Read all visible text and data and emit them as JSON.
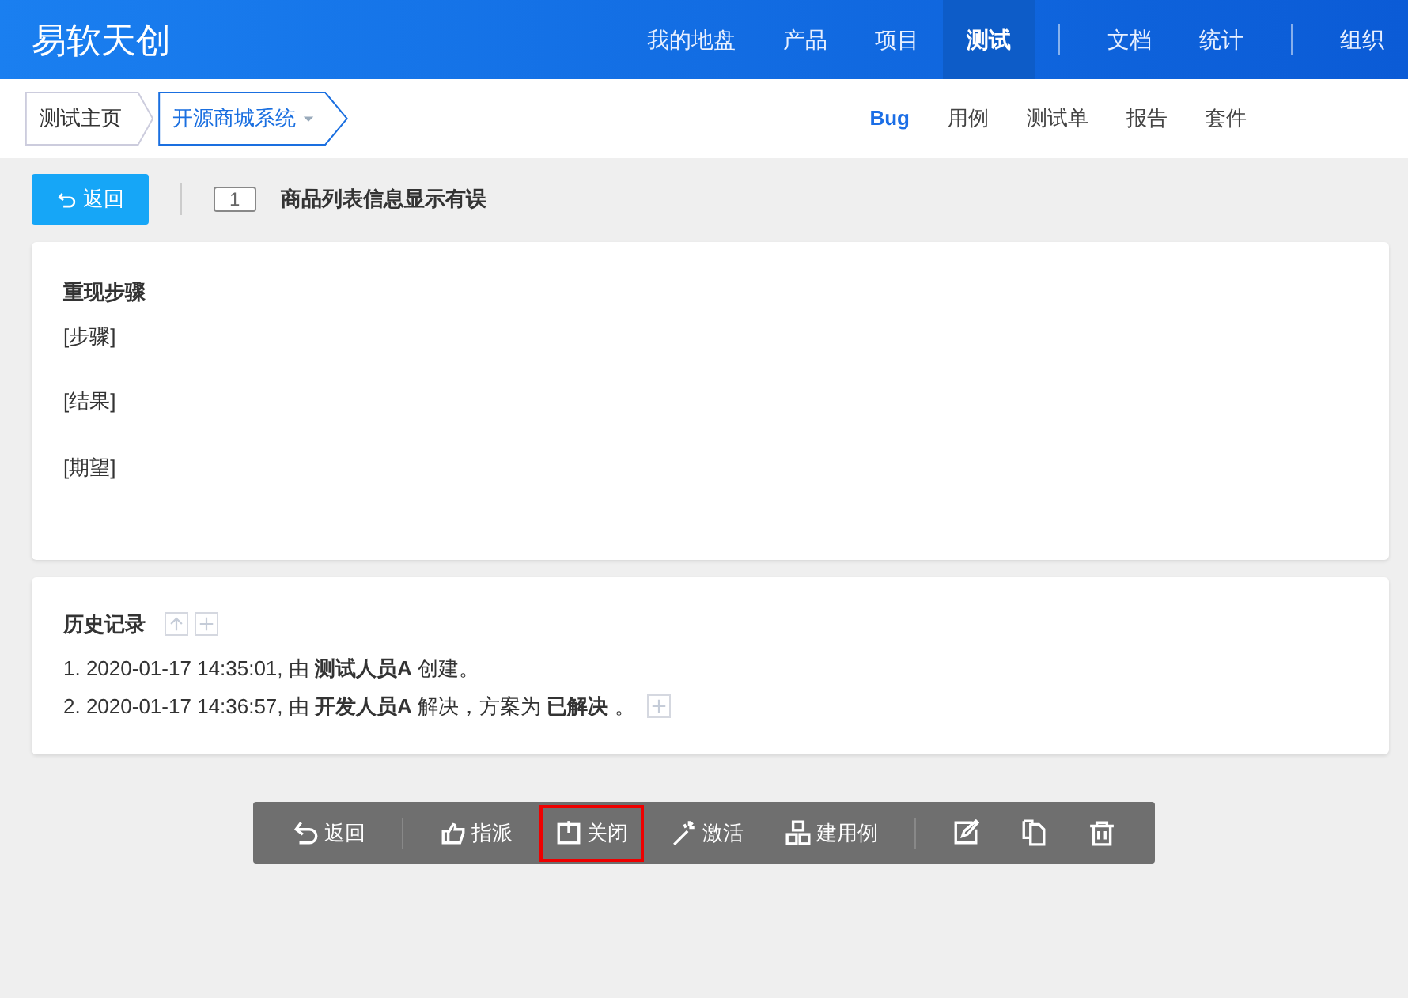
{
  "header": {
    "brand": "易软天创",
    "nav": [
      {
        "kind": "link",
        "label": "我的地盘",
        "selected": false
      },
      {
        "kind": "link",
        "label": "产品",
        "selected": false
      },
      {
        "kind": "link",
        "label": "项目",
        "selected": false
      },
      {
        "kind": "link",
        "label": "测试",
        "selected": true
      },
      {
        "kind": "divider"
      },
      {
        "kind": "link",
        "label": "文档",
        "selected": false
      },
      {
        "kind": "link",
        "label": "统计",
        "selected": false
      },
      {
        "kind": "divider"
      },
      {
        "kind": "link",
        "label": "组织",
        "selected": false
      }
    ]
  },
  "breadcrumb": [
    {
      "label": "测试主页",
      "selected": false,
      "dropdown": false
    },
    {
      "label": "开源商城系统",
      "selected": true,
      "dropdown": true
    }
  ],
  "subnav": [
    {
      "label": "Bug",
      "selected": true
    },
    {
      "label": "用例",
      "selected": false
    },
    {
      "label": "测试单",
      "selected": false
    },
    {
      "label": "报告",
      "selected": false
    },
    {
      "label": "套件",
      "selected": false
    }
  ],
  "title_bar": {
    "back": "返回",
    "id": "1",
    "title": "商品列表信息显示有误"
  },
  "steps": {
    "heading": "重现步骤",
    "lines": [
      "[步骤]",
      "[结果]",
      "[期望]"
    ]
  },
  "history": {
    "heading": "历史记录",
    "entries": [
      {
        "text": "1. 2020-01-17 14:35:01, 由 **测试人员A** 创建。",
        "expandable": false
      },
      {
        "text": "2. 2020-01-17 14:36:57, 由 **开发人员A** 解决，方案为 **已解决** 。",
        "expandable": true
      }
    ]
  },
  "actions": [
    {
      "kind": "back",
      "label": "返回",
      "highlighted": false
    },
    {
      "kind": "divider"
    },
    {
      "kind": "assign",
      "label": "指派",
      "highlighted": false
    },
    {
      "kind": "close",
      "label": "关闭",
      "highlighted": true
    },
    {
      "kind": "activate",
      "label": "激活",
      "highlighted": false
    },
    {
      "kind": "case",
      "label": "建用例",
      "highlighted": false
    },
    {
      "kind": "divider"
    },
    {
      "kind": "edit",
      "highlighted": false
    },
    {
      "kind": "copy",
      "highlighted": false
    },
    {
      "kind": "delete",
      "highlighted": false
    }
  ]
}
